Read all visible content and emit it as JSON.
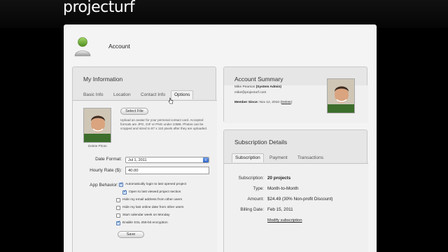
{
  "app": {
    "logo": "projecturf"
  },
  "page": {
    "title": "Account"
  },
  "my_information": {
    "title": "My Information",
    "tabs": [
      "Basic Info",
      "Location",
      "Contact Info",
      "Options"
    ],
    "active_tab": "Options",
    "select_file_label": "Select File",
    "upload_help": "Upload an avatar for your personal contact card. Accepted formats are JPG, GIF or PNG under 10MB. Photos can be cropped and sized to 87 x 110 pixels after they are uploaded.",
    "delete_photo_label": "Delete Photo",
    "date_format_label": "Date Format:",
    "date_format_value": "Jul 1, 2011",
    "hourly_rate_label": "Hourly Rate ($):",
    "hourly_rate_value": "40.00",
    "app_behavior_label": "App Behavior:",
    "options": [
      {
        "label": "Automatically login to last opened project",
        "checked": true
      },
      {
        "label": "Open to last viewed project section",
        "checked": true
      },
      {
        "label": "Hide my email address from other users",
        "checked": false
      },
      {
        "label": "Hide my last online date from other users",
        "checked": false
      },
      {
        "label": "Start calendar week on Monday",
        "checked": false
      },
      {
        "label": "Enable SSL 256-bit encryption",
        "checked": true
      }
    ],
    "save_label": "Save"
  },
  "account_summary": {
    "title": "Account Summary",
    "name_line_name": "Mike Pearson",
    "name_line_role": "(System Admin)",
    "email": "mike@projecturf.com",
    "member_since_label": "Member Since:",
    "member_since_value": "Nov 12, 2010",
    "delete_link": "Delete"
  },
  "subscription": {
    "title": "Subscription Details",
    "tabs": [
      "Subscription",
      "Payment",
      "Transactions"
    ],
    "active_tab": "Subscription",
    "rows": [
      {
        "label": "Subscription:",
        "value": "20 projects",
        "bold": true
      },
      {
        "label": "Type:",
        "value": "Month-to-Month",
        "bold": false
      },
      {
        "label": "Amount:",
        "value": "$24.49 (30% Non-profit Discount)",
        "bold": false
      },
      {
        "label": "Billing Date:",
        "value": "Feb 15, 2011",
        "bold": false
      }
    ],
    "modify_link": "Modify subscription"
  },
  "colors": {
    "link_green": "#5a9e1c",
    "select_blue": "#2d63c9",
    "background": "#000000",
    "panel": "#e6e6e6"
  }
}
